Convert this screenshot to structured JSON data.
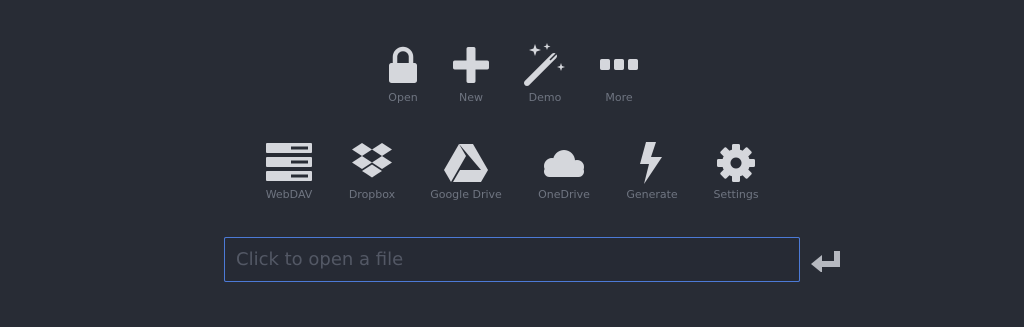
{
  "quick_actions": [
    {
      "label": "Open",
      "icon": "lock-icon"
    },
    {
      "label": "New",
      "icon": "plus-icon"
    },
    {
      "label": "Demo",
      "icon": "magic-wand-icon"
    },
    {
      "label": "More",
      "icon": "ellipsis-icon"
    }
  ],
  "sources": [
    {
      "label": "WebDAV",
      "icon": "server-icon"
    },
    {
      "label": "Dropbox",
      "icon": "dropbox-icon"
    },
    {
      "label": "Google Drive",
      "icon": "google-drive-icon"
    },
    {
      "label": "OneDrive",
      "icon": "onedrive-cloud-icon"
    },
    {
      "label": "Generate",
      "icon": "lightning-bolt-icon"
    },
    {
      "label": "Settings",
      "icon": "gear-icon"
    }
  ],
  "file_input": {
    "placeholder": "Click to open a file",
    "value": ""
  },
  "enter_button": {
    "icon": "enter-return-icon"
  },
  "colors": {
    "background": "#282c35",
    "icon": "#d5d7dc",
    "label": "#6e7480",
    "input_border": "#4c7ad6"
  }
}
